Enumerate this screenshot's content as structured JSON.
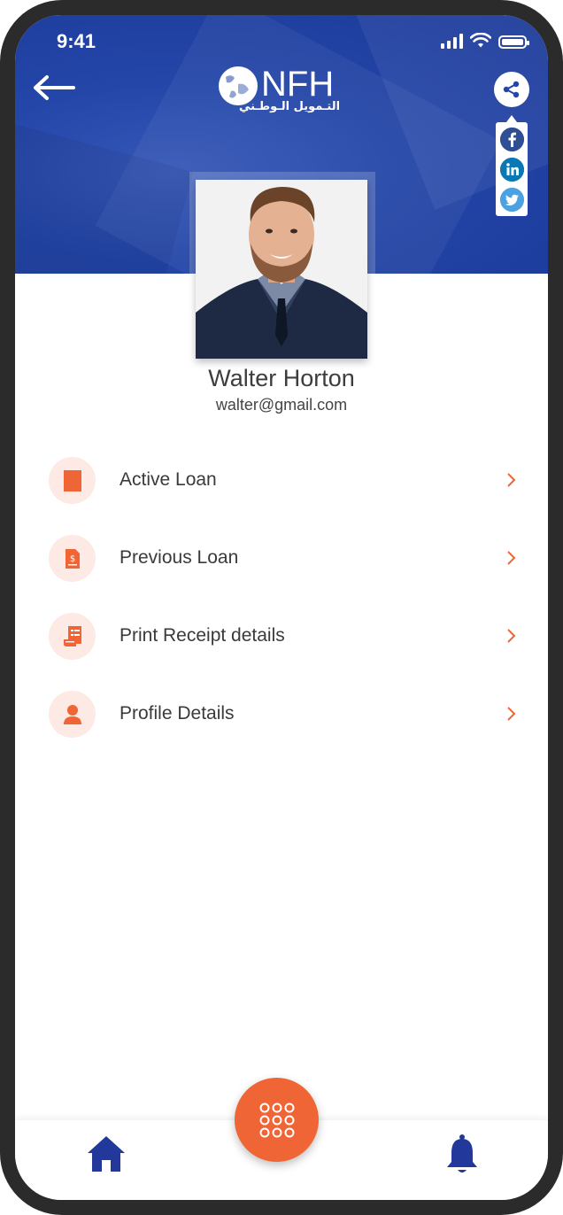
{
  "status_bar": {
    "time": "9:41"
  },
  "header": {
    "logo_text": "NFH",
    "logo_arabic": "التـمويل الـوطـني"
  },
  "profile": {
    "name": "Walter Horton",
    "email": "walter@gmail.com"
  },
  "menu": [
    {
      "label": "Active Loan",
      "icon": "loan-book-icon"
    },
    {
      "label": "Previous Loan",
      "icon": "document-dollar-icon"
    },
    {
      "label": "Print Receipt details",
      "icon": "receipt-icon"
    },
    {
      "label": "Profile Details",
      "icon": "user-icon"
    }
  ],
  "social": [
    "facebook-icon",
    "linkedin-icon",
    "twitter-icon"
  ],
  "colors": {
    "header_blue": "#1f3f9f",
    "accent_orange": "#ef6535",
    "icon_bg": "#fdeae4",
    "nav_blue": "#22389a"
  }
}
